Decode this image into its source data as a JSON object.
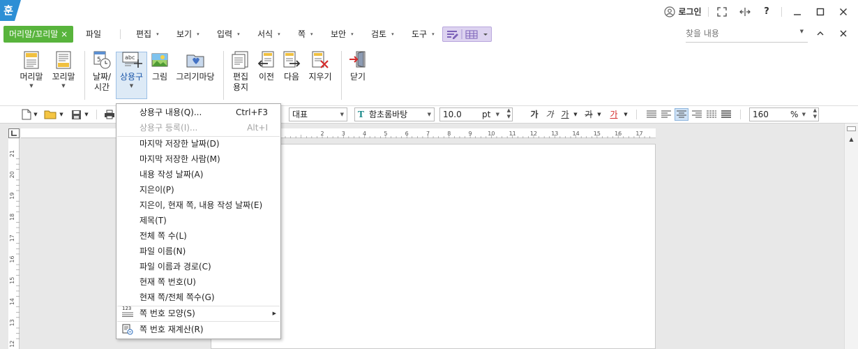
{
  "app": {
    "logo": "훈"
  },
  "titlebar": {
    "login": "로그인",
    "help": "?"
  },
  "context_tab": {
    "label": "머리말/꼬리말 ×"
  },
  "menus": [
    {
      "label": "파일",
      "arrow": ""
    },
    {
      "label": "편집",
      "arrow": "▾"
    },
    {
      "label": "보기",
      "arrow": "▾"
    },
    {
      "label": "입력",
      "arrow": "▾"
    },
    {
      "label": "서식",
      "arrow": "▾"
    },
    {
      "label": "쪽",
      "arrow": "▾"
    },
    {
      "label": "보안",
      "arrow": "▾"
    },
    {
      "label": "검토",
      "arrow": "▾"
    },
    {
      "label": "도구",
      "arrow": "▾"
    }
  ],
  "search": {
    "placeholder": "찾을 내용"
  },
  "ribbon": {
    "header": "머리말",
    "footer": "꼬리말",
    "date_time_1": "날짜/",
    "date_time_2": "시간",
    "autotext": "상용구",
    "picture": "그림",
    "drawing": "그리기마당",
    "edit_paper_1": "편집",
    "edit_paper_2": "용지",
    "previous": "이전",
    "next": "다음",
    "delete": "지우기",
    "close": "닫기"
  },
  "format_bar": {
    "style": "대표",
    "font": "함초롬바탕",
    "font_size": "10.0",
    "unit": "pt",
    "bold": "가",
    "italic": "가",
    "underline": "가",
    "strike": "가",
    "font_color": "가",
    "zoom": "160",
    "zoom_unit": "%"
  },
  "rulers": {
    "horizontal": [
      "2",
      "3",
      "4",
      "5",
      "6",
      "7",
      "8",
      "9",
      "10",
      "11",
      "12",
      "13",
      "14",
      "15",
      "16",
      "17"
    ],
    "vertical": [
      "21",
      "20",
      "19",
      "18",
      "17",
      "16",
      "15",
      "14",
      "13",
      "12"
    ]
  },
  "dropdown": {
    "items": [
      {
        "label": "상용구 내용(Q)...",
        "shortcut": "Ctrl+F3"
      },
      {
        "label": "상용구 등록(I)...",
        "shortcut": "Alt+I"
      },
      {
        "label": "마지막 저장한 날짜(D)"
      },
      {
        "label": "마지막 저장한 사람(M)"
      },
      {
        "label": "내용 작성 날짜(A)"
      },
      {
        "label": "지은이(P)"
      },
      {
        "label": "지은이, 현재 쪽, 내용 작성 날짜(E)"
      },
      {
        "label": "제목(T)"
      },
      {
        "label": "전체 쪽 수(L)"
      },
      {
        "label": "파일 이름(N)"
      },
      {
        "label": "파일 이름과 경로(C)"
      },
      {
        "label": "현재 쪽 번호(U)"
      },
      {
        "label": "현재 쪽/전체 쪽수(G)"
      },
      {
        "label": "쪽 번호 모양(S)",
        "icon_text": "123"
      },
      {
        "label": "쪽 번호 재계산(R)"
      }
    ]
  },
  "colors": {
    "context_tab": "#58b43c",
    "logo": "#2d8fd5",
    "selected_ribbon": "#ddeaf6",
    "workspace": "#e8e8e8"
  }
}
